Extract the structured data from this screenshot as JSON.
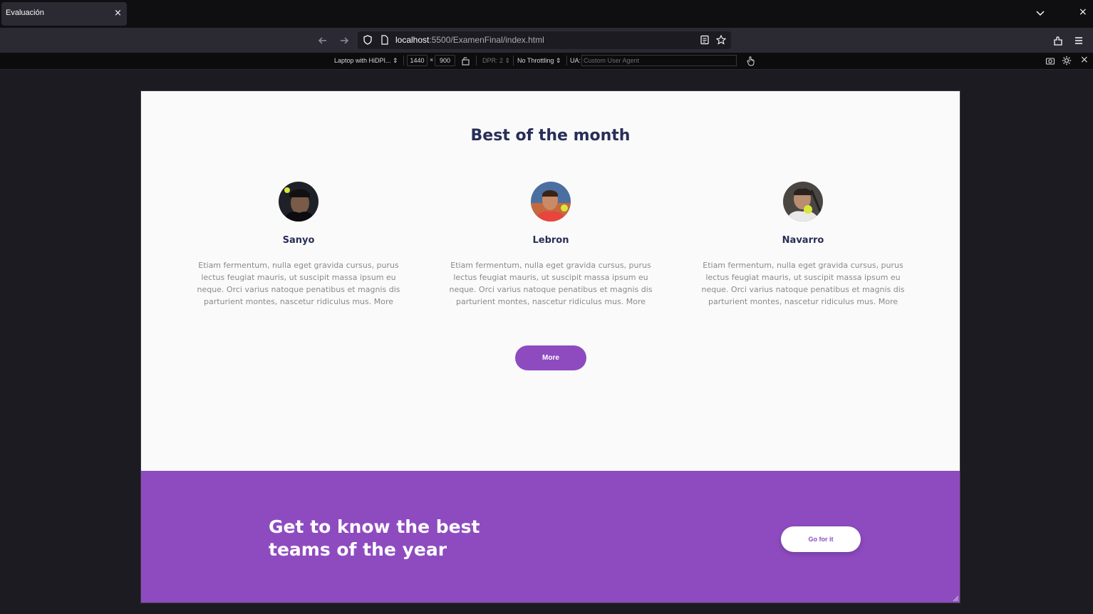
{
  "browser": {
    "tab_title": "Evaluación",
    "url_host": "localhost",
    "url_rest": ":5500/ExamenFinal/index.html"
  },
  "rdm": {
    "device": "Laptop with HiDPI...",
    "width": "1440",
    "times": "×",
    "height": "900",
    "dpr": "DPR: 2",
    "throttling": "No Throttling",
    "ua_label": "UA:",
    "ua_placeholder": "Custom User Agent"
  },
  "page": {
    "section_title": "Best of the month",
    "players": [
      {
        "name": "Sanyo",
        "text": "Etiam fermentum, nulla eget gravida cursus, purus lectus feugiat mauris, ut suscipit massa ipsum eu neque. Orci varius natoque penatibus et magnis dis parturient montes, nascetur ridiculus mus. More"
      },
      {
        "name": "Lebron",
        "text": "Etiam fermentum, nulla eget gravida cursus, purus lectus feugiat mauris, ut suscipit massa ipsum eu neque. Orci varius natoque penatibus et magnis dis parturient montes, nascetur ridiculus mus. More"
      },
      {
        "name": "Navarro",
        "text": "Etiam fermentum, nulla eget gravida cursus, purus lectus feugiat mauris, ut suscipit massa ipsum eu neque. Orci varius natoque penatibus et magnis dis parturient montes, nascetur ridiculus mus. More"
      }
    ],
    "more_label": "More",
    "banner_title": "Get to know the best teams of the year",
    "go_label": "Go for it",
    "accent_color": "#8e4bc0",
    "title_color": "#282e57"
  }
}
